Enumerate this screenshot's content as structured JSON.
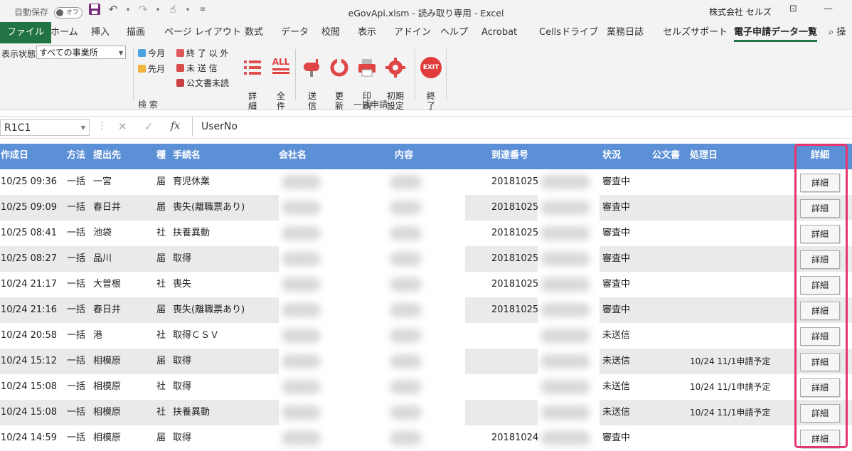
{
  "titlebar": {
    "autosave_label": "自動保存",
    "autosave_state": "オフ",
    "document_title": "eGovApi.xlsm - 読み取り専用 - Excel",
    "account": "株式会社 セルズ"
  },
  "tabs": [
    {
      "label": "ファイル"
    },
    {
      "label": "ホーム"
    },
    {
      "label": "挿入"
    },
    {
      "label": "描画"
    },
    {
      "label": "ページ レイアウト"
    },
    {
      "label": "数式"
    },
    {
      "label": "データ"
    },
    {
      "label": "校閲"
    },
    {
      "label": "表示"
    },
    {
      "label": "アドイン"
    },
    {
      "label": "ヘルプ"
    },
    {
      "label": "Acrobat"
    },
    {
      "label": "Cellsドライブ"
    },
    {
      "label": "業務日誌"
    },
    {
      "label": "セルズサポート"
    },
    {
      "label": "電子申請データ一覧"
    },
    {
      "label": "操"
    }
  ],
  "ribbon": {
    "display_state_label": "表示状態",
    "display_state_value": "すべての事業所",
    "this_month": "今月",
    "last_month": "先月",
    "finished_excluded": "終 了 以 外",
    "unsent": "未 送 信",
    "unread_official": "公文書未読",
    "detail": "詳\n細",
    "all": "全\n件",
    "search_group": "検 索",
    "send": "送\n信",
    "update": "更\n新",
    "print": "印\n刷",
    "initial_settings": "初期\n設定",
    "exit": "終\n了",
    "exit_icon_text": "EXIT",
    "all_icon_text": "ALL",
    "batch_group": "一括申請"
  },
  "formula_bar": {
    "name_box": "R1C1",
    "fx": "fx",
    "formula": "UserNo"
  },
  "table": {
    "headers": {
      "created": "作成日",
      "method": "方法",
      "destination": "提出先",
      "kind": "種",
      "procedure": "手続名",
      "company": "会社名",
      "content": "内容",
      "arrival": "到達番号",
      "status": "状況",
      "official": "公文書",
      "processed": "処理日",
      "detail": "詳細"
    },
    "detail_button_label": "詳細",
    "rows": [
      {
        "created": "10/25 09:36",
        "method": "一括",
        "destination": "一宮",
        "kind": "届",
        "procedure": "育児休業",
        "arrival": "20181025",
        "status": "審査中",
        "processed": "",
        "detail": "詳細"
      },
      {
        "created": "10/25 09:09",
        "method": "一括",
        "destination": "春日井",
        "kind": "届",
        "procedure": "喪失(離職票あり)",
        "arrival": "20181025",
        "status": "審査中",
        "processed": "",
        "detail": "詳細"
      },
      {
        "created": "10/25 08:41",
        "method": "一括",
        "destination": "池袋",
        "kind": "社",
        "procedure": "扶養異動",
        "arrival": "20181025",
        "status": "審査中",
        "processed": "",
        "detail": "詳細"
      },
      {
        "created": "10/25 08:27",
        "method": "一括",
        "destination": "品川",
        "kind": "届",
        "procedure": "取得",
        "arrival": "20181025",
        "status": "審査中",
        "processed": "",
        "detail": "詳細"
      },
      {
        "created": "10/24 21:17",
        "method": "一括",
        "destination": "大曽根",
        "kind": "社",
        "procedure": "喪失",
        "arrival": "20181025",
        "status": "審査中",
        "processed": "",
        "detail": "詳細"
      },
      {
        "created": "10/24 21:16",
        "method": "一括",
        "destination": "春日井",
        "kind": "届",
        "procedure": "喪失(離職票あり)",
        "arrival": "20181025",
        "status": "審査中",
        "processed": "",
        "detail": "詳細"
      },
      {
        "created": "10/24 20:58",
        "method": "一括",
        "destination": "港",
        "kind": "社",
        "procedure": "取得ＣＳＶ",
        "arrival": "",
        "status": "未送信",
        "processed": "",
        "detail": "詳細"
      },
      {
        "created": "10/24 15:12",
        "method": "一括",
        "destination": "相模原",
        "kind": "届",
        "procedure": "取得",
        "arrival": "",
        "status": "未送信",
        "processed": "10/24 11/1申請予定",
        "detail": "詳細"
      },
      {
        "created": "10/24 15:08",
        "method": "一括",
        "destination": "相模原",
        "kind": "社",
        "procedure": "取得",
        "arrival": "",
        "status": "未送信",
        "processed": "10/24 11/1申請予定",
        "detail": "詳細"
      },
      {
        "created": "10/24 15:08",
        "method": "一括",
        "destination": "相模原",
        "kind": "社",
        "procedure": "扶養異動",
        "arrival": "",
        "status": "未送信",
        "processed": "10/24 11/1申請予定",
        "detail": "詳細"
      },
      {
        "created": "10/24 14:59",
        "method": "一括",
        "destination": "相模原",
        "kind": "届",
        "procedure": "取得",
        "arrival": "20181024",
        "status": "審査中",
        "processed": "",
        "detail": "詳細"
      }
    ]
  },
  "colors": {
    "header_blue": "#5b8fd6",
    "excel_green": "#217346",
    "highlight": "#e8346c",
    "row_alt": "#eaeaea"
  }
}
